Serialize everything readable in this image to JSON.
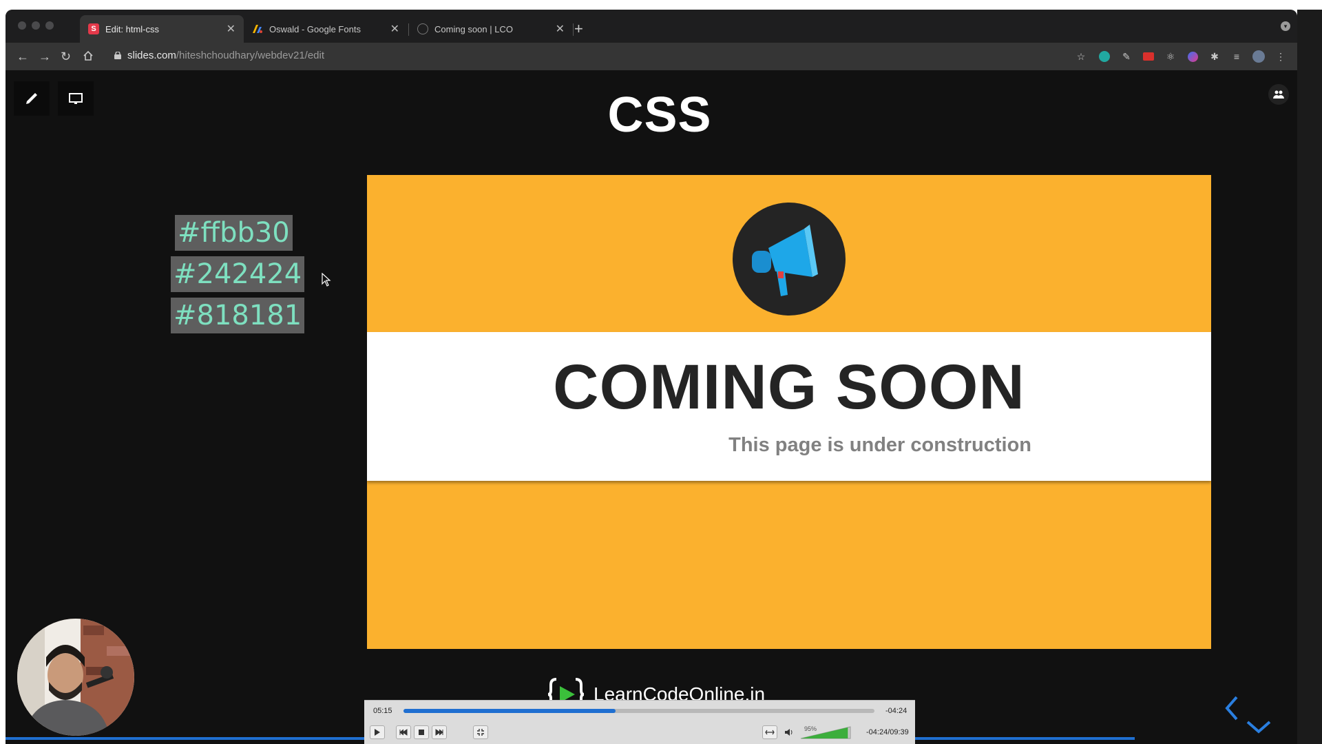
{
  "browser": {
    "tabs": [
      {
        "title": "Edit: html-css",
        "favicon": "S",
        "active": true
      },
      {
        "title": "Oswald - Google Fonts",
        "favicon": "google-fonts-icon",
        "active": false
      },
      {
        "title": "Coming soon | LCO",
        "favicon": "globe-icon",
        "active": false
      }
    ],
    "new_tab": "+",
    "url_domain": "slides.com",
    "url_path": "/hiteshchoudhary/webdev21/edit"
  },
  "slide": {
    "title": "CSS",
    "colors": [
      "#ffbb30",
      "#242424",
      "#818181"
    ]
  },
  "image": {
    "heading": "COMING SOON",
    "subheading": "This page is under construction",
    "background": "#fbb12e",
    "icon": "megaphone-icon"
  },
  "branding": {
    "text": "LearnCodeOnline.in"
  },
  "video": {
    "elapsed": "05:15",
    "remaining": "-04:24",
    "duration_label": "-04:24/09:39",
    "volume_label": "95%",
    "progress": 0.45,
    "volume": 0.95
  }
}
